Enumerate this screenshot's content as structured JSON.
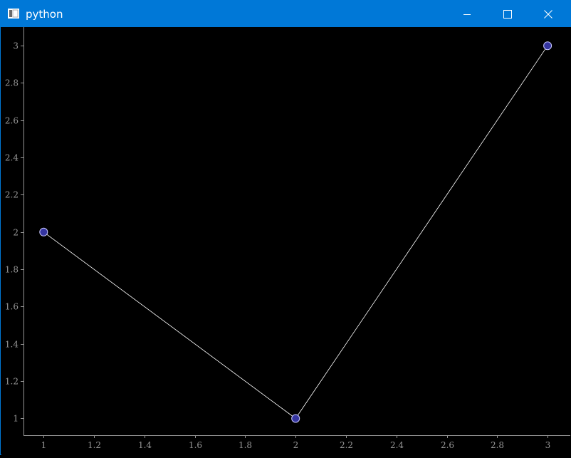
{
  "window": {
    "title": "python",
    "icons": {
      "app": "window-app-icon",
      "minimize": "minimize-icon",
      "maximize": "maximize-icon",
      "close": "close-icon"
    },
    "colors": {
      "titlebar": "#0078d7",
      "background": "#000000"
    }
  },
  "chart_data": {
    "type": "line",
    "x": [
      1,
      2,
      3
    ],
    "series": [
      {
        "values": [
          2,
          1,
          3
        ],
        "line_color": "#ffffff",
        "marker_color": "#3535a0",
        "marker_edge": "#c8c8ff",
        "marker": "circle"
      }
    ],
    "xlim": [
      0.92,
      3.09
    ],
    "ylim": [
      0.91,
      3.1
    ],
    "xticks": [
      1,
      1.2,
      1.4,
      1.6,
      1.8,
      2,
      2.2,
      2.4,
      2.6,
      2.8,
      3
    ],
    "yticks": [
      1,
      1.2,
      1.4,
      1.6,
      1.8,
      2,
      2.2,
      2.4,
      2.6,
      2.8,
      3
    ],
    "xtick_labels": [
      "1",
      "1.2",
      "1.4",
      "1.6",
      "1.8",
      "2",
      "2.2",
      "2.4",
      "2.6",
      "2.8",
      "3"
    ],
    "ytick_labels": [
      "1",
      "1.2",
      "1.4",
      "1.6",
      "1.8",
      "2",
      "2.2",
      "2.4",
      "2.6",
      "2.8",
      "3"
    ],
    "title": "",
    "xlabel": "",
    "ylabel": "",
    "grid": false,
    "axis_color": "#969696",
    "tick_label_color": "#969696"
  }
}
